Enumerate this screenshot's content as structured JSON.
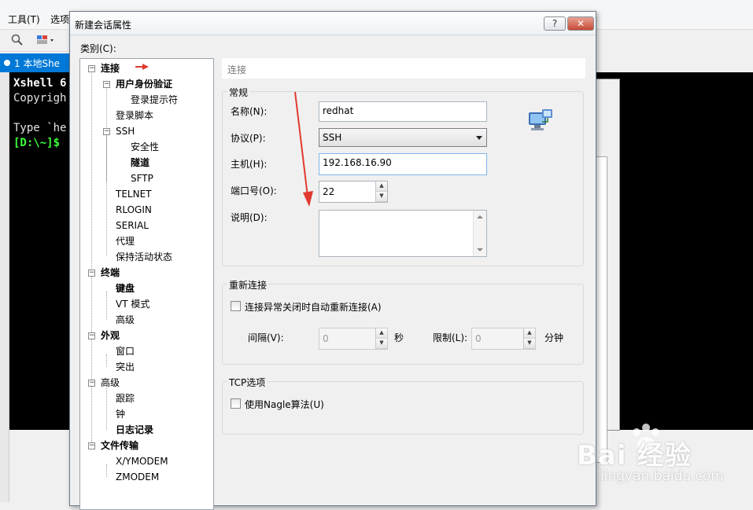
{
  "background": {
    "menu_tools": "工具(T)",
    "menu_options": "选项",
    "tab_label": "1 本地She",
    "terminal": {
      "line1": "Xshell 6",
      "line2": "Copyrigh",
      "line3": "Type `he",
      "prompt": "[D:\\~]$"
    }
  },
  "dialog": {
    "title": "新建会话属性",
    "help_button": "?",
    "close_button": "✕",
    "category_label": "类别(C):",
    "tree": [
      {
        "label": "连接",
        "bold": true,
        "expander": "⊟"
      },
      {
        "label": "用户身份验证",
        "bold": true,
        "expander": "⊟"
      },
      {
        "label": "登录提示符",
        "bold": false
      },
      {
        "label": "登录脚本",
        "bold": false
      },
      {
        "label": "SSH",
        "bold": false,
        "expander": "⊟"
      },
      {
        "label": "安全性",
        "bold": false
      },
      {
        "label": "隧道",
        "bold": true
      },
      {
        "label": "SFTP",
        "bold": false
      },
      {
        "label": "TELNET",
        "bold": false
      },
      {
        "label": "RLOGIN",
        "bold": false
      },
      {
        "label": "SERIAL",
        "bold": false
      },
      {
        "label": "代理",
        "bold": false
      },
      {
        "label": "保持活动状态",
        "bold": false
      },
      {
        "label": "终端",
        "bold": true,
        "expander": "⊟"
      },
      {
        "label": "键盘",
        "bold": true
      },
      {
        "label": "VT 模式",
        "bold": false
      },
      {
        "label": "高级",
        "bold": false
      },
      {
        "label": "外观",
        "bold": true,
        "expander": "⊟"
      },
      {
        "label": "窗口",
        "bold": false
      },
      {
        "label": "突出",
        "bold": false
      },
      {
        "label": "高级",
        "bold": false,
        "expander": "⊟"
      },
      {
        "label": "跟踪",
        "bold": false
      },
      {
        "label": "钟",
        "bold": false
      },
      {
        "label": "日志记录",
        "bold": true
      },
      {
        "label": "文件传输",
        "bold": true,
        "expander": "⊟"
      },
      {
        "label": "X/YMODEM",
        "bold": false
      },
      {
        "label": "ZMODEM",
        "bold": false
      }
    ],
    "panel_header": "连接",
    "general": {
      "title": "常规",
      "name_label": "名称(N):",
      "name_value": "redhat",
      "protocol_label": "协议(P):",
      "protocol_value": "SSH",
      "host_label": "主机(H):",
      "host_value": "192.168.16.90",
      "port_label": "端口号(O):",
      "port_value": "22",
      "desc_label": "说明(D):",
      "desc_value": ""
    },
    "reconnect": {
      "title": "重新连接",
      "auto_reconnect_label": "连接异常关闭时自动重新连接(A)",
      "interval_label": "间隔(V):",
      "interval_value": "0",
      "interval_unit": "秒",
      "limit_label": "限制(L):",
      "limit_value": "0",
      "limit_unit": "分钟"
    },
    "tcp": {
      "title": "TCP选项",
      "nagle_label": "使用Nagle算法(U)"
    }
  },
  "watermark": {
    "brand": "Bai 经验",
    "url": "jingyan.baidu.com"
  },
  "colors": {
    "accent": "#0078d7",
    "annotation_red": "#e03a2f"
  }
}
